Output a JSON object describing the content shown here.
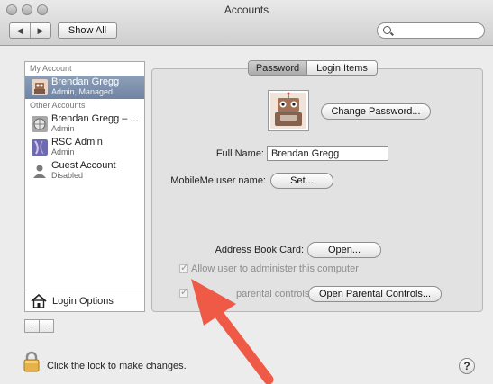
{
  "window": {
    "title": "Accounts"
  },
  "toolbar": {
    "back_label": "◀",
    "forward_label": "▶",
    "show_all_label": "Show All",
    "search_placeholder": ""
  },
  "sidebar": {
    "my_account_header": "My Account",
    "other_accounts_header": "Other Accounts",
    "accounts": [
      {
        "name": "Brendan Gregg",
        "role": "Admin, Managed"
      },
      {
        "name": "Brendan Gregg – ...",
        "role": "Admin"
      },
      {
        "name": "RSC Admin",
        "role": "Admin"
      },
      {
        "name": "Guest Account",
        "role": "Disabled"
      }
    ],
    "login_options_label": "Login Options",
    "add_label": "+",
    "remove_label": "−"
  },
  "tabs": {
    "password": "Password",
    "login_items": "Login Items"
  },
  "panel": {
    "change_password_label": "Change Password...",
    "full_name_label": "Full Name:",
    "full_name_value": "Brendan Gregg",
    "mobileme_label": "MobileMe user name:",
    "set_label": "Set...",
    "address_book_label": "Address Book Card:",
    "open_label": "Open...",
    "allow_admin_label": "Allow user to administer this computer",
    "parental_label": "parental controls",
    "open_parental_label": "Open Parental Controls...",
    "check_mark": "✓"
  },
  "footer": {
    "lock_text": "Click the lock to make changes.",
    "help_label": "?"
  },
  "colors": {
    "arrow": "#ef5a47",
    "selection": "#7d90ad"
  }
}
